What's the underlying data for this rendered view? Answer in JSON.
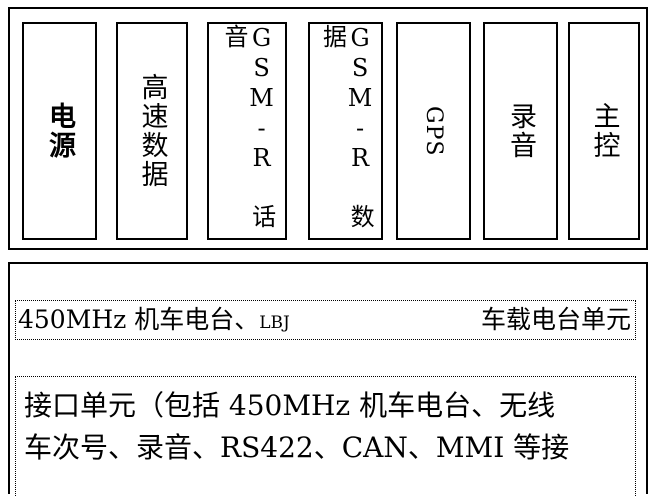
{
  "modules": [
    {
      "id": "power",
      "label": "电源"
    },
    {
      "id": "highspeed-data",
      "label": "高速数据"
    },
    {
      "id": "gsmr-voice",
      "label": "GSM-R 话音"
    },
    {
      "id": "gsmr-data",
      "label": "GSM-R 数据"
    },
    {
      "id": "gps",
      "label": "GPS"
    },
    {
      "id": "recording",
      "label": "录音"
    },
    {
      "id": "main-control",
      "label": "主控"
    }
  ],
  "radio_unit": {
    "left_label": "450MHz 机车电台、",
    "lbj": "LBJ",
    "right_label": "车载电台单元"
  },
  "interface_unit": {
    "line1": "接口单元（包括 450MHz 机车电台、无线",
    "line2": "车次号、录音、RS422、CAN、MMI 等接"
  }
}
